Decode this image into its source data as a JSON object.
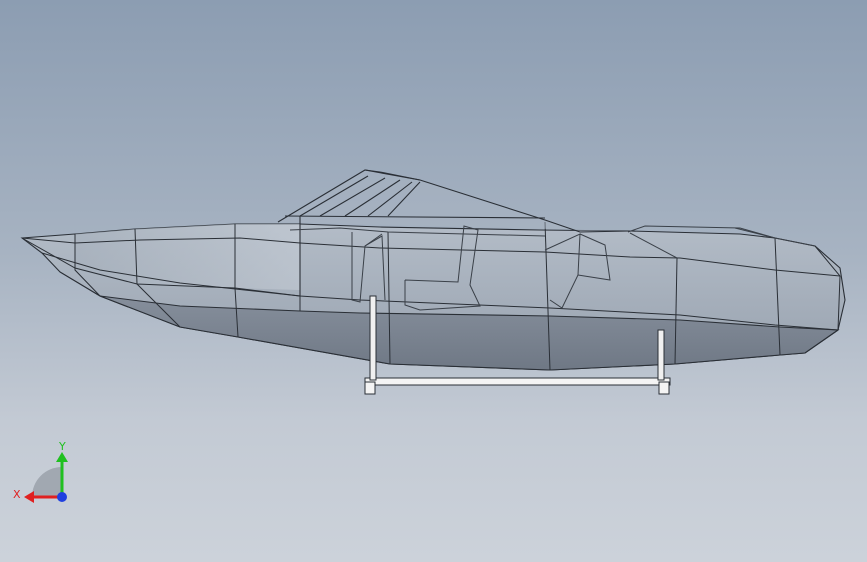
{
  "viewport": {
    "background_top": "#8c9db2",
    "background_bottom": "#ccd2da",
    "model": "boat-hull-wireframe"
  },
  "triad": {
    "x_label": "X",
    "y_label": "Y",
    "x_color": "#e02020",
    "y_color": "#20c020",
    "z_color": "#2040e0"
  }
}
